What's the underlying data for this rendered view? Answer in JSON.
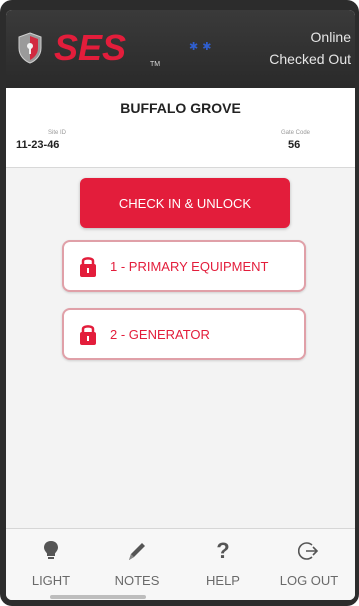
{
  "header": {
    "logo_text": "SES",
    "trademark": "TM",
    "status_line1": "Online",
    "status_line2": "Checked Out",
    "bluetooth_icon": "bluetooth-icon"
  },
  "site": {
    "name": "BUFFALO GROVE",
    "site_id_caption": "Site ID",
    "site_id": "11-23-46",
    "gate_code_caption": "Gate Code",
    "gate_code": "56"
  },
  "actions": {
    "check_in_label": "CHECK IN & UNLOCK",
    "locks": [
      {
        "label": "1 - PRIMARY EQUIPMENT",
        "icon": "lock-icon"
      },
      {
        "label": "2 - GENERATOR",
        "icon": "lock-icon"
      }
    ]
  },
  "nav": {
    "items": [
      {
        "label": "LIGHT",
        "icon": "lightbulb-icon"
      },
      {
        "label": "NOTES",
        "icon": "pencil-icon"
      },
      {
        "label": "HELP",
        "icon": "question-icon"
      },
      {
        "label": "LOG OUT",
        "icon": "logout-icon"
      }
    ]
  },
  "colors": {
    "accent": "#e31d3b",
    "header_bg": "#2f2f2f",
    "main_bg": "#f3f3f3",
    "bluetooth": "#2f5fd0"
  }
}
